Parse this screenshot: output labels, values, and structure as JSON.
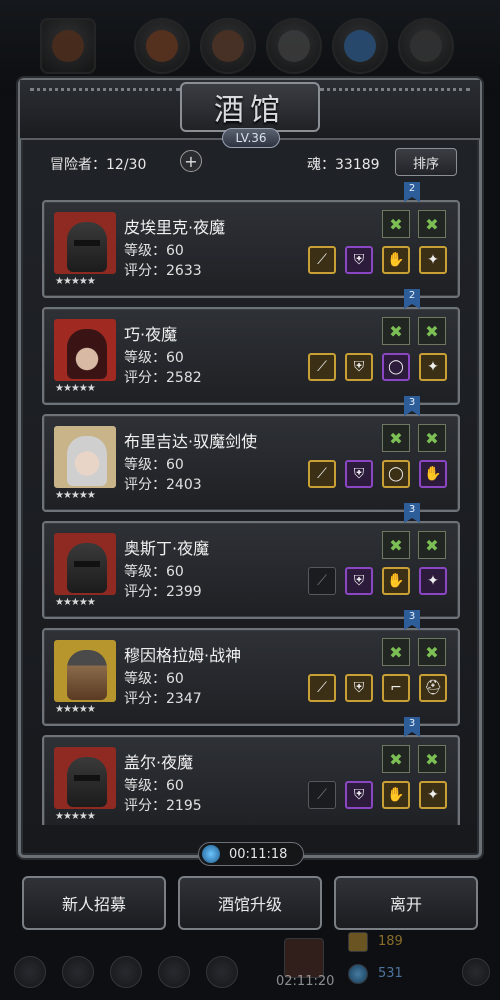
{
  "window": {
    "title": "酒馆",
    "level": "LV.36"
  },
  "stats": {
    "adventurers_label": "冒险者：",
    "adventurers_count": "12/30",
    "soul_label": "魂：",
    "soul_value": "33189",
    "sort_label": "排序"
  },
  "heroes": [
    {
      "name": "皮埃里克·夜魔",
      "level": "等级：60",
      "score": "评分：2633",
      "stars": "★★★★★",
      "portrait": "dark-helmet",
      "rank": "2",
      "equip": [
        {
          "type": "gold",
          "icon": "sword-icon"
        },
        {
          "type": "purple",
          "icon": "armor-icon"
        },
        {
          "type": "gold",
          "icon": "gauntlet-icon"
        },
        {
          "type": "gold",
          "icon": "amulet-icon"
        }
      ]
    },
    {
      "name": "巧·夜魔",
      "level": "等级：60",
      "score": "评分：2582",
      "stars": "★★★★★",
      "portrait": "red-hood",
      "rank": "2",
      "equip": [
        {
          "type": "gold",
          "icon": "sword-icon"
        },
        {
          "type": "gold",
          "icon": "armor-icon"
        },
        {
          "type": "purple",
          "icon": "ring-icon"
        },
        {
          "type": "gold",
          "icon": "amulet-icon"
        }
      ]
    },
    {
      "name": "布里吉达·驭魔剑使",
      "level": "等级：60",
      "score": "评分：2403",
      "stars": "★★★★★",
      "portrait": "silver-hair",
      "rank": "3",
      "equip": [
        {
          "type": "gold",
          "icon": "sword-icon"
        },
        {
          "type": "purple",
          "icon": "armor-icon"
        },
        {
          "type": "gold",
          "icon": "ring-icon"
        },
        {
          "type": "purple",
          "icon": "gauntlet-icon"
        }
      ]
    },
    {
      "name": "奥斯丁·夜魔",
      "level": "等级：60",
      "score": "评分：2399",
      "stars": "★★★★★",
      "portrait": "dark-helmet",
      "rank": "3",
      "equip": [
        {
          "type": "empty",
          "icon": "sword-icon"
        },
        {
          "type": "purple",
          "icon": "armor-icon"
        },
        {
          "type": "gold",
          "icon": "gauntlet-icon"
        },
        {
          "type": "purple",
          "icon": "amulet-icon"
        }
      ]
    },
    {
      "name": "穆因格拉姆·战神",
      "level": "等级：60",
      "score": "评分：2347",
      "stars": "★★★★★",
      "portrait": "bearded",
      "rank": "3",
      "equip": [
        {
          "type": "gold",
          "icon": "sword-icon"
        },
        {
          "type": "gold",
          "icon": "armor-icon"
        },
        {
          "type": "gold",
          "icon": "boots-icon"
        },
        {
          "type": "gold",
          "icon": "helmet-icon"
        }
      ]
    },
    {
      "name": "盖尔·夜魔",
      "level": "等级：60",
      "score": "评分：2195",
      "stars": "★★★★★",
      "portrait": "dark-helmet",
      "rank": "3",
      "equip": [
        {
          "type": "empty",
          "icon": "sword-icon"
        },
        {
          "type": "purple",
          "icon": "armor-icon"
        },
        {
          "type": "gold",
          "icon": "gauntlet-icon"
        },
        {
          "type": "gold",
          "icon": "amulet-icon"
        }
      ]
    }
  ],
  "timer": "00:11:18",
  "buttons": {
    "recruit": "新人招募",
    "upgrade": "酒馆升级",
    "leave": "离开"
  },
  "dock": {
    "time": "02:11:20",
    "gold": "189",
    "gems": "531"
  },
  "colors": {
    "gold_rarity": "#c9a035",
    "purple_rarity": "#8b46c4",
    "bookmark_blue": "#2d5e9a"
  }
}
